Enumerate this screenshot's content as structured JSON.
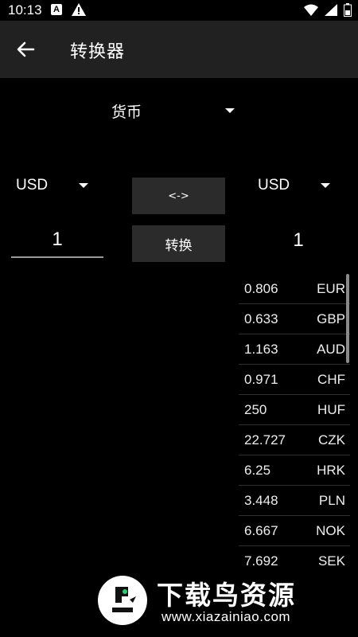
{
  "status_bar": {
    "time": "10:13",
    "notif_letter": "A"
  },
  "app_bar": {
    "title": "转换器"
  },
  "category": {
    "selected": "货币"
  },
  "from": {
    "currency": "USD",
    "amount": "1"
  },
  "to": {
    "currency": "USD",
    "amount": "1"
  },
  "buttons": {
    "swap_label": "<->",
    "convert_label": "转换"
  },
  "rates": [
    {
      "value": "0.806",
      "code": "EUR"
    },
    {
      "value": "0.633",
      "code": "GBP"
    },
    {
      "value": "1.163",
      "code": "AUD"
    },
    {
      "value": "0.971",
      "code": "CHF"
    },
    {
      "value": "250",
      "code": "HUF"
    },
    {
      "value": "22.727",
      "code": "CZK"
    },
    {
      "value": "6.25",
      "code": "HRK"
    },
    {
      "value": "3.448",
      "code": "PLN"
    },
    {
      "value": "6.667",
      "code": "NOK"
    },
    {
      "value": "7.692",
      "code": "SEK"
    }
  ],
  "watermark": {
    "title": "下载鸟资源",
    "url": "www.xiazainiao.com"
  },
  "colors": {
    "app_bar": "#212121",
    "background": "#000000",
    "button": "#2b2b2b",
    "logo_green": "#2ecc71"
  }
}
